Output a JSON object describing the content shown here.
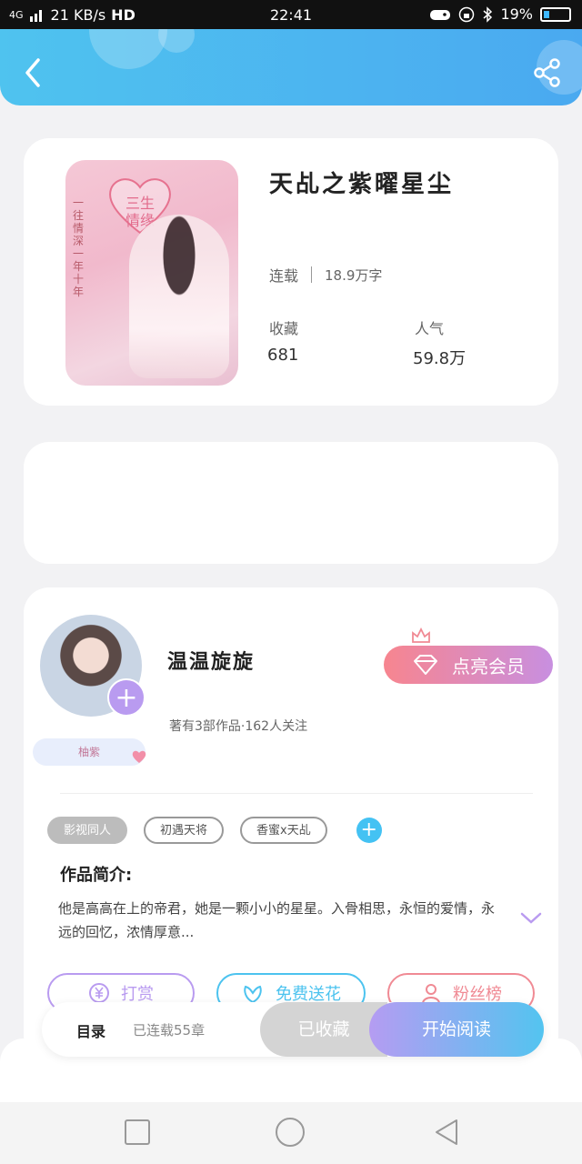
{
  "status_bar": {
    "network": "4G",
    "speed": "21 KB/s",
    "hd": "HD",
    "time": "22:41",
    "battery": "19%"
  },
  "book": {
    "title": "天乩之紫曜星尘",
    "status": "连载",
    "word_count": "18.9万字",
    "favorites_label": "收藏",
    "favorites_value": "681",
    "popularity_label": "人气",
    "popularity_value": "59.8万",
    "cover_heart_text": "三生\n情缘",
    "cover_vertical_text": "一往情深 一年十年"
  },
  "author": {
    "name": "温温旋旋",
    "meta": "著有3部作品·162人关注",
    "badge": "柚紫",
    "vip_button": "点亮会员",
    "tags": [
      "影视同人",
      "初遇天将",
      "香蜜x天乩"
    ],
    "intro_title": "作品简介:",
    "intro_text": "他是高高在上的帝君，她是一颗小小的星星。入骨相思，永恒的爱情，永远的回忆，浓情厚意..."
  },
  "actions": {
    "reward": "打赏",
    "flowers": "免费送花",
    "fans": "粉丝榜"
  },
  "bottom_bar": {
    "toc": "目录",
    "toc_sub": "已连载55章",
    "favorited": "已收藏",
    "read": "开始阅读"
  },
  "colors": {
    "header": "#4aa9f0",
    "vip_gradient_start": "#f7858f",
    "vip_gradient_end": "#c88fe0",
    "read_gradient_start": "#b59cf2",
    "read_gradient_end": "#53c4f0",
    "reward": "#b99bf0",
    "flowers": "#4cc3ef",
    "fans": "#f08a94"
  },
  "icons": {
    "back": "back-arrow-icon",
    "share": "share-icon",
    "crown": "crown-icon",
    "diamond": "diamond-icon",
    "yen": "yen-icon",
    "flower": "flower-icon",
    "person": "person-icon",
    "chevron": "chevron-down-icon"
  }
}
